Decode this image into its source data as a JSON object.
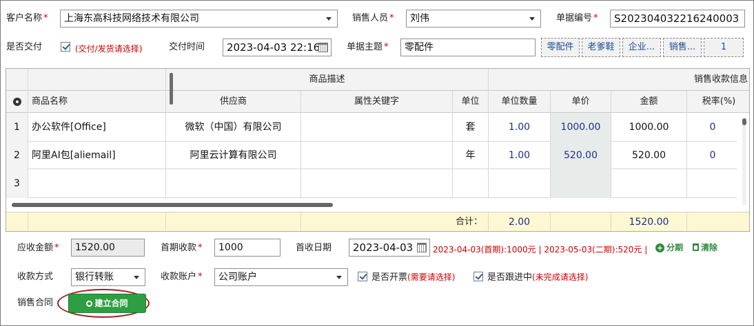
{
  "row1": {
    "customer_label": "客户名称",
    "customer_value": "上海东高科技网络技术有限公司",
    "sales_label": "销售人员",
    "sales_value": "刘伟",
    "docno_label": "单据编号",
    "docno_value": "S202304032216240003"
  },
  "row2": {
    "delivered_label": "是否交付",
    "delivered_hint": "(交付/发货请选择)",
    "delivery_time_label": "交付时间",
    "delivery_time_value": "2023-04-03 22:16",
    "subject_label": "单据主题",
    "subject_value": "零配件",
    "tags": [
      "零配件",
      "老爹鞋",
      "企业...",
      "销售...",
      "1"
    ]
  },
  "grid": {
    "group_desc": "商品描述",
    "group_sales": "销售收款信息",
    "columns": [
      "商品名称",
      "供应商",
      "属性关键字",
      "单位",
      "单位数量",
      "单价",
      "金额",
      "税率(%)"
    ],
    "rows": [
      {
        "no": "1",
        "name": "办公软件[Office]",
        "supplier": "微软（中国）有限公司",
        "attr": "",
        "unit": "套",
        "qty": "1.00",
        "price": "1000.00",
        "amount": "1000.00",
        "tax": "0"
      },
      {
        "no": "2",
        "name": "阿里AI包[aliemail]",
        "supplier": "阿里云计算有限公司",
        "attr": "",
        "unit": "年",
        "qty": "1.00",
        "price": "520.00",
        "amount": "520.00",
        "tax": "0"
      },
      {
        "no": "3",
        "name": "",
        "supplier": "",
        "attr": "",
        "unit": "",
        "qty": "",
        "price": "",
        "amount": "",
        "tax": ""
      }
    ],
    "total_label": "合计：",
    "total_qty": "2.00",
    "total_amount": "1520.00"
  },
  "row3": {
    "receivable_label": "应收金额",
    "receivable_value": "1520.00",
    "first_label": "首期收款",
    "first_value": "1000",
    "first_date_label": "首收日期",
    "first_date_value": "2023-04-03",
    "schedule": "2023-04-03(首期):1000元 | 2023-05-03(二期):520元 |",
    "split_label": "分期",
    "clear_label": "清除"
  },
  "row4": {
    "method_label": "收款方式",
    "method_value": "银行转账",
    "account_label": "收款账户",
    "account_value": "公司账户",
    "invoice_label": "是否开票",
    "invoice_hint": "(需要请选择)",
    "follow_label": "是否跟进中",
    "follow_hint": "(未完成请选择)"
  },
  "row5": {
    "contract_label": "销售合同",
    "create_button": "建立合同"
  },
  "colors": {
    "accent_green": "#2e9e43",
    "required_red": "#cc0000",
    "value_blue": "#1a2e8a"
  }
}
